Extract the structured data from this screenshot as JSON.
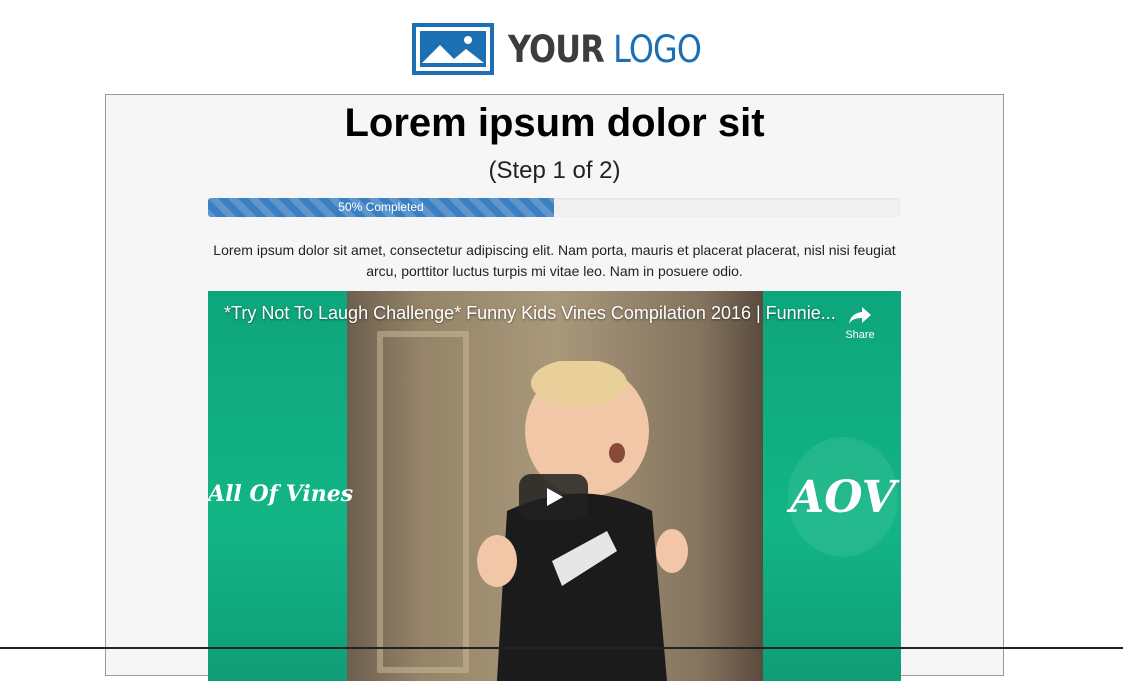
{
  "logo": {
    "word1": "YOUR",
    "word2": "LOGO"
  },
  "header": {
    "title": "Lorem ipsum dolor sit",
    "step": "(Step 1 of 2)"
  },
  "progress": {
    "value": 50,
    "label": "50% Completed"
  },
  "description": "Lorem ipsum dolor sit amet, consectetur adipiscing elit. Nam porta, mauris et placerat placerat, nisl nisi feugiat arcu, porttitor luctus turpis mi vitae leo. Nam in posuere odio.",
  "video": {
    "title": "*Try Not To Laugh Challenge* Funny Kids Vines Compilation 2016 | Funnie...",
    "share_label": "Share",
    "brand_left": "All Of Vines",
    "brand_right": "AOV",
    "icons": {
      "share": "share-icon",
      "play": "play-icon"
    }
  },
  "colors": {
    "accent": "#3a7fc1",
    "brand": "#1d6fb3",
    "video_bg": "#12b585"
  }
}
